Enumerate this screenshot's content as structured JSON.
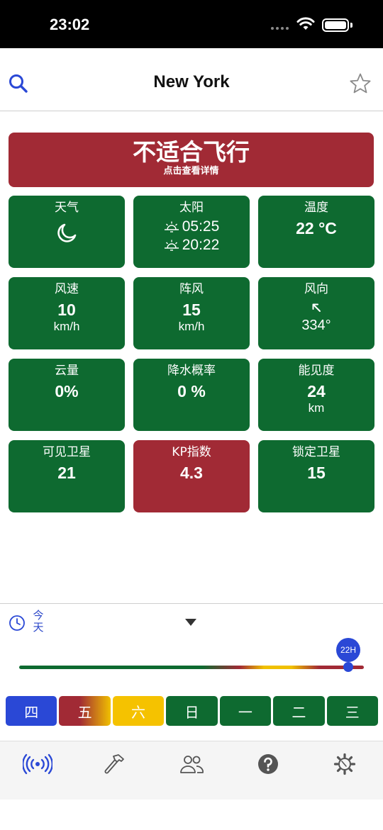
{
  "status_bar": {
    "time": "23:02"
  },
  "header": {
    "title": "New York"
  },
  "banner": {
    "title": "不适合飞行",
    "subtitle": "点击查看详情"
  },
  "cards": {
    "weather": {
      "label": "天气",
      "icon": "moon-icon"
    },
    "sun": {
      "label": "太阳",
      "sunrise": "05:25",
      "sunset": "20:22"
    },
    "temperature": {
      "label": "温度",
      "value": "22 °C"
    },
    "wind_speed": {
      "label": "风速",
      "value": "10",
      "unit": "km/h"
    },
    "gust": {
      "label": "阵风",
      "value": "15",
      "unit": "km/h"
    },
    "wind_direction": {
      "label": "风向",
      "value": "334°"
    },
    "cloud": {
      "label": "云量",
      "value": "0%"
    },
    "precip": {
      "label": "降水概率",
      "value": "0 %"
    },
    "visibility": {
      "label": "能见度",
      "value": "24",
      "unit": "km"
    },
    "satellites_visible": {
      "label": "可见卫星",
      "value": "21"
    },
    "kp_index": {
      "label": "KP指数",
      "value": "4.3"
    },
    "satellites_locked": {
      "label": "锁定卫星",
      "value": "15"
    }
  },
  "timeline": {
    "day_label": "今天",
    "hour_label": "22H",
    "slider_fraction": 0.955,
    "days": [
      "四",
      "五",
      "六",
      "日",
      "一",
      "二",
      "三"
    ]
  },
  "colors": {
    "good": "#0e6a30",
    "bad": "#a12a35",
    "warn": "#f5c200",
    "accent": "#2a48d6"
  },
  "tabbar": {
    "items": [
      "antenna-icon",
      "hammer-icon",
      "people-icon",
      "help-icon",
      "settings-gear-icon"
    ]
  }
}
